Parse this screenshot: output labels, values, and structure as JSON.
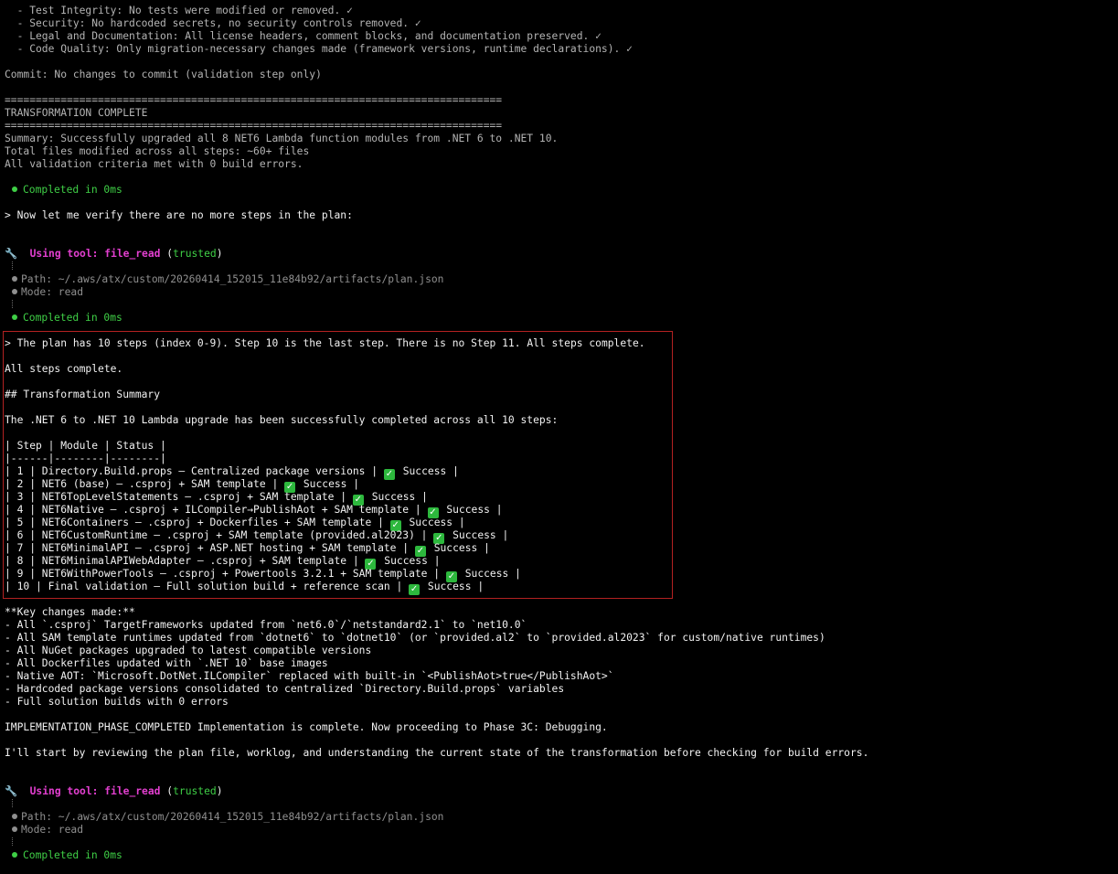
{
  "colors": {
    "background": "#000000",
    "text": "#b4b4b4",
    "bright_text": "#f2f2f2",
    "dim_text": "#8f8f8f",
    "success_green": "#3fcf46",
    "tool_magenta": "#e33fd0",
    "highlight_border": "#b32121",
    "checkbox_green": "#2db83d"
  },
  "validation_lines": [
    "  - Test Integrity: No tests were modified or removed. ✓",
    "  - Security: No hardcoded secrets, no security controls removed. ✓",
    "  - Legal and Documentation: All license headers, comment blocks, and documentation preserved. ✓",
    "  - Code Quality: Only migration-necessary changes made (framework versions, runtime declarations). ✓"
  ],
  "commit_line": "Commit: No changes to commit (validation step only)",
  "separator": "================================================================================",
  "transformation_title": "TRANSFORMATION COMPLETE",
  "summary_lines": [
    "Summary: Successfully upgraded all 8 NET6 Lambda function modules from .NET 6 to .NET 10.",
    "Total files modified across all steps: ~60+ files",
    "All validation criteria met with 0 build errors."
  ],
  "completed_text": "Completed in 0ms",
  "verify_prompt": "Now let me verify there are no more steps in the plan:",
  "tool_call": {
    "using_label": "Using tool:",
    "tool_name": "file_read",
    "trust": "(trusted)",
    "path_line": "Path: ~/.aws/atx/custom/20260414_152015_11e84b92/artifacts/plan.json",
    "mode_line": "Mode: read"
  },
  "highlighted": {
    "intro": "The plan has 10 steps (index 0-9). Step 10 is the last step. There is no Step 11. All steps complete.",
    "all_complete": "All steps complete.",
    "heading": "## Transformation Summary",
    "description": "The .NET 6 to .NET 10 Lambda upgrade has been successfully completed across all 10 steps:",
    "table_header": "| Step | Module | Status |",
    "table_divider": "|------|--------|--------|",
    "rows": [
      {
        "prefix": "| 1 | Directory.Build.props — Centralized package versions | ",
        "status": "Success |"
      },
      {
        "prefix": "| 2 | NET6 (base) — .csproj + SAM template | ",
        "status": "Success |"
      },
      {
        "prefix": "| 3 | NET6TopLevelStatements — .csproj + SAM template | ",
        "status": "Success |"
      },
      {
        "prefix": "| 4 | NET6Native — .csproj + ILCompiler→PublishAot + SAM template | ",
        "status": "Success |"
      },
      {
        "prefix": "| 5 | NET6Containers — .csproj + Dockerfiles + SAM template | ",
        "status": "Success |"
      },
      {
        "prefix": "| 6 | NET6CustomRuntime — .csproj + SAM template (provided.al2023) | ",
        "status": "Success |"
      },
      {
        "prefix": "| 7 | NET6MinimalAPI — .csproj + ASP.NET hosting + SAM template | ",
        "status": "Success |"
      },
      {
        "prefix": "| 8 | NET6MinimalAPIWebAdapter — .csproj + SAM template | ",
        "status": "Success |"
      },
      {
        "prefix": "| 9 | NET6WithPowerTools — .csproj + Powertools 3.2.1 + SAM template | ",
        "status": "Success |"
      },
      {
        "prefix": "| 10 | Final validation — Full solution build + reference scan | ",
        "status": "Success |"
      }
    ]
  },
  "key_changes": {
    "title": "**Key changes made:**",
    "items": [
      "- All `.csproj` TargetFrameworks updated from `net6.0`/`netstandard2.1` to `net10.0`",
      "- All SAM template runtimes updated from `dotnet6` to `dotnet10` (or `provided.al2` to `provided.al2023` for custom/native runtimes)",
      "- All NuGet packages upgraded to latest compatible versions",
      "- All Dockerfiles updated with `.NET 10` base images",
      "- Native AOT: `Microsoft.DotNet.ILCompiler` replaced with built-in `<PublishAot>true</PublishAot>`",
      "- Hardcoded package versions consolidated to centralized `Directory.Build.props` variables",
      "- Full solution builds with 0 errors"
    ]
  },
  "implementation_line": "IMPLEMENTATION_PHASE_COMPLETED Implementation is complete. Now proceeding to Phase 3C: Debugging.",
  "review_line": "I'll start by reviewing the plan file, worklog, and understanding the current state of the transformation before checking for build errors.",
  "prompt_marker": ">",
  "check_glyph": "✓",
  "wrench_glyph": "🔧"
}
